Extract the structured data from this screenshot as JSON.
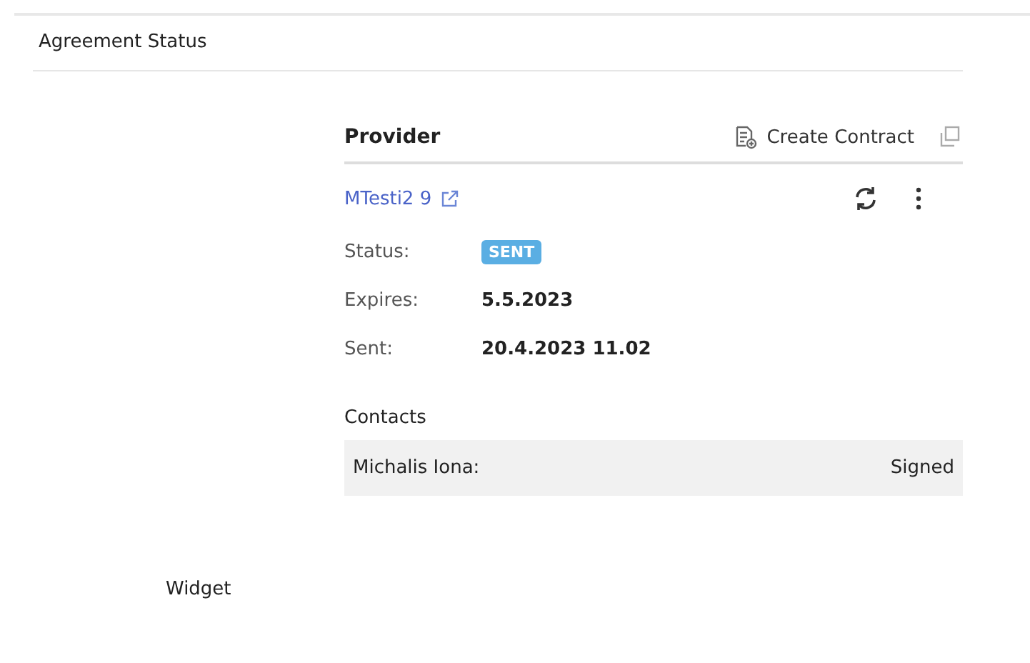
{
  "section": {
    "title": "Agreement Status"
  },
  "provider": {
    "title": "Provider",
    "create_button": "Create Contract",
    "name": "MTesti2 9"
  },
  "fields": [
    {
      "kind": "badge",
      "label": "Status:",
      "value": "SENT"
    },
    {
      "kind": "text",
      "label": "Expires:",
      "value": "5.5.2023"
    },
    {
      "kind": "text",
      "label": "Sent:",
      "value": "20.4.2023 11.02"
    }
  ],
  "contacts": {
    "title": "Contacts",
    "rows": [
      {
        "name": "Michalis Iona:",
        "status": "Signed"
      }
    ]
  },
  "footer": {
    "label": "Widget"
  }
}
